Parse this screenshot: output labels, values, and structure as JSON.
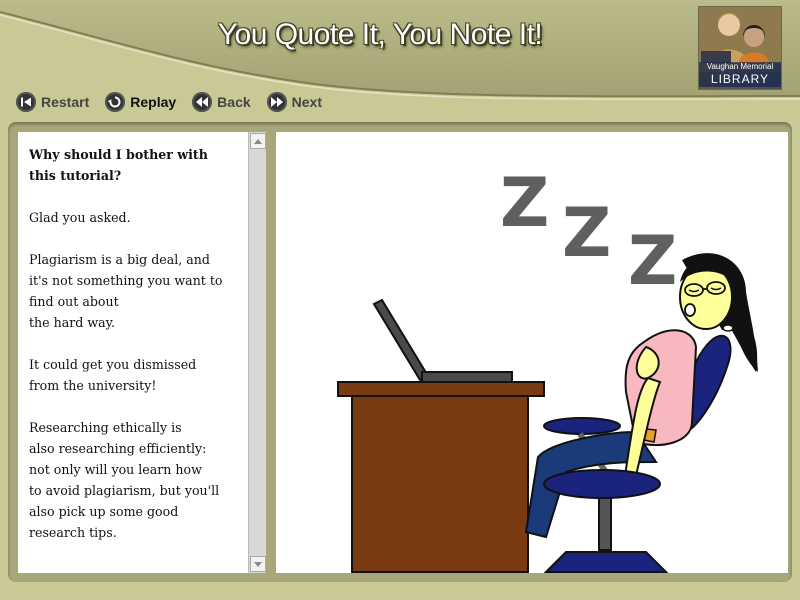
{
  "header": {
    "title": "You Quote It, You Note It!",
    "logo": {
      "line1": "Vaughan Memorial",
      "line2": "LIBRARY"
    }
  },
  "nav": {
    "restart": "Restart",
    "replay": "Replay",
    "back": "Back",
    "next": "Next"
  },
  "text_panel": {
    "heading": [
      "Why should I bother with",
      "this tutorial?"
    ],
    "paragraphs": [
      [
        "Glad you asked."
      ],
      [
        "Plagiarism is a big deal, and",
        "it's not something you want to",
        "find out about",
        "the hard way."
      ],
      [
        "It could get you dismissed",
        "from the university!"
      ],
      [
        "Researching ethically is",
        "also researching efficiently:",
        "not only will you learn how",
        "to avoid plagiarism, but you'll",
        "also pick up some good",
        "research tips."
      ]
    ]
  },
  "illustration": {
    "sleep_letters": [
      "Z",
      "Z",
      "Z"
    ]
  },
  "colors": {
    "background": "#c9c996",
    "header_band": "#b4b483",
    "content_frame": "#a7a77a",
    "desk": "#7a3a12",
    "chair": "#1a237e",
    "skin": "#ffff99",
    "shirt": "#f8b8c0"
  }
}
